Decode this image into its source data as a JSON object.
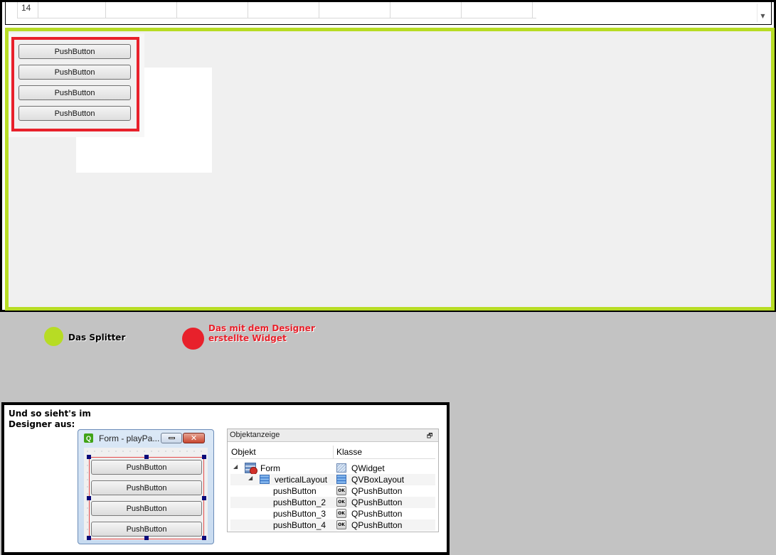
{
  "table": {
    "row_number": "14",
    "scroll_down_glyph": "▼"
  },
  "splitter_widget": {
    "buttons": [
      "PushButton",
      "PushButton",
      "PushButton",
      "PushButton"
    ]
  },
  "legend": {
    "splitter_label": "Das Splitter",
    "designer_label": "Das mit dem Designer erstellte Widget",
    "splitter_color": "#b7dc24",
    "designer_color": "#e8212b"
  },
  "designer": {
    "caption": "Und so sieht's im Designer aus:",
    "form_window": {
      "title": "Form - playPa...",
      "app_icon_glyph": "Q",
      "close_glyph": "✕",
      "buttons": [
        "PushButton",
        "PushButton",
        "PushButton",
        "PushButton"
      ]
    },
    "object_inspector": {
      "title": "Objektanzeige",
      "float_glyph": "🗗",
      "col_object": "Objekt",
      "col_class": "Klasse",
      "rows": [
        {
          "name": "Form",
          "class": "QWidget",
          "class_icon": "widget-icon"
        },
        {
          "name": "verticalLayout",
          "class": "QVBoxLayout",
          "class_icon": "layout-icon"
        },
        {
          "name": "pushButton",
          "class": "QPushButton",
          "class_icon": "ok-button-icon"
        },
        {
          "name": "pushButton_2",
          "class": "QPushButton",
          "class_icon": "ok-button-icon"
        },
        {
          "name": "pushButton_3",
          "class": "QPushButton",
          "class_icon": "ok-button-icon"
        },
        {
          "name": "pushButton_4",
          "class": "QPushButton",
          "class_icon": "ok-button-icon"
        }
      ],
      "ok_icon_text": "OK",
      "expand_glyph": "◢"
    }
  }
}
